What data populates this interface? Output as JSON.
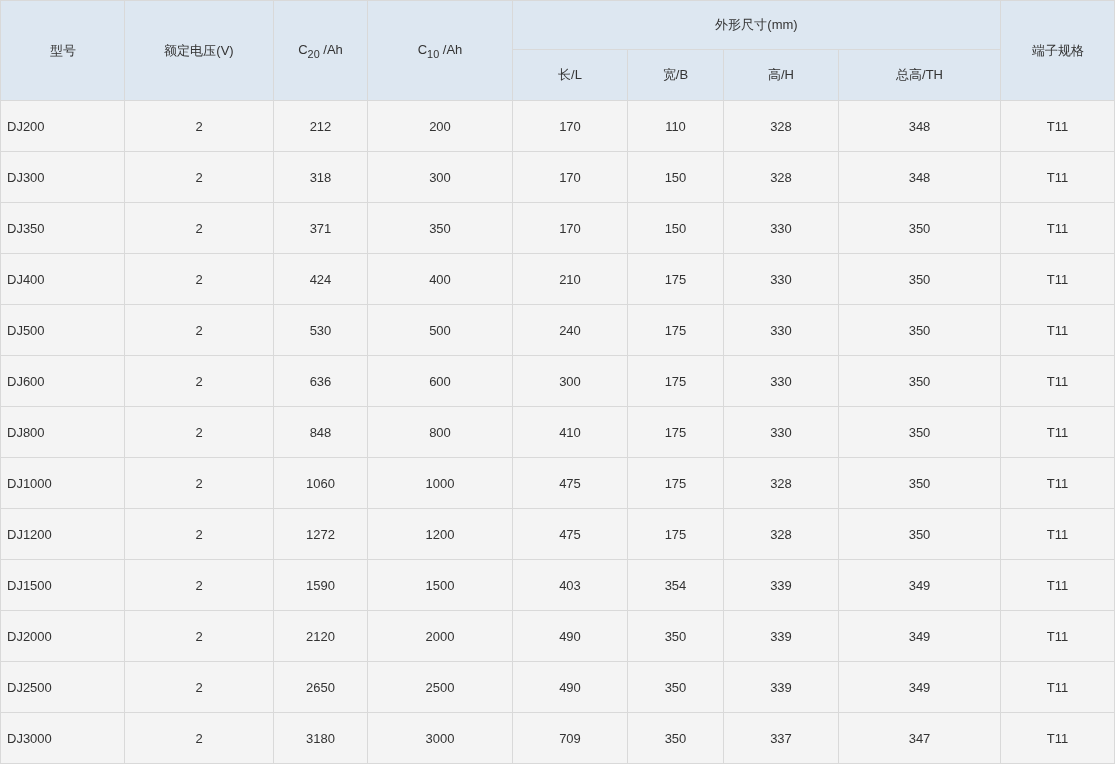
{
  "table": {
    "header_rows": [
      [
        {
          "label": "型号",
          "rowspan": 2
        },
        {
          "label": "额定电压(V)",
          "rowspan": 2
        },
        {
          "label": "C$_{20}$ /Ah",
          "rowspan": 2
        },
        {
          "label": "C$_{10}$ /Ah",
          "rowspan": 2
        },
        {
          "label": "外形尺寸(mm)",
          "colspan": 4
        },
        {
          "label": "端子规格",
          "rowspan": 2
        }
      ],
      [
        {
          "label": "长/L"
        },
        {
          "label": "宽/B"
        },
        {
          "label": "高/H"
        },
        {
          "label": "总高/TH"
        }
      ]
    ],
    "rows": [
      [
        "DJ200",
        "2",
        "212",
        "200",
        "170",
        "110",
        "328",
        "348",
        "T11"
      ],
      [
        "DJ300",
        "2",
        "318",
        "300",
        "170",
        "150",
        "328",
        "348",
        "T11"
      ],
      [
        "DJ350",
        "2",
        "371",
        "350",
        "170",
        "150",
        "330",
        "350",
        "T11"
      ],
      [
        "DJ400",
        "2",
        "424",
        "400",
        "210",
        "175",
        "330",
        "350",
        "T11"
      ],
      [
        "DJ500",
        "2",
        "530",
        "500",
        "240",
        "175",
        "330",
        "350",
        "T11"
      ],
      [
        "DJ600",
        "2",
        "636",
        "600",
        "300",
        "175",
        "330",
        "350",
        "T11"
      ],
      [
        "DJ800",
        "2",
        "848",
        "800",
        "410",
        "175",
        "330",
        "350",
        "T11"
      ],
      [
        "DJ1000",
        "2",
        "1060",
        "1000",
        "475",
        "175",
        "328",
        "350",
        "T11"
      ],
      [
        "DJ1200",
        "2",
        "1272",
        "1200",
        "475",
        "175",
        "328",
        "350",
        "T11"
      ],
      [
        "DJ1500",
        "2",
        "1590",
        "1500",
        "403",
        "354",
        "339",
        "349",
        "T11"
      ],
      [
        "DJ2000",
        "2",
        "2120",
        "2000",
        "490",
        "350",
        "339",
        "349",
        "T11"
      ],
      [
        "DJ2500",
        "2",
        "2650",
        "2500",
        "490",
        "350",
        "339",
        "349",
        "T11"
      ],
      [
        "DJ3000",
        "2",
        "3180",
        "3000",
        "709",
        "350",
        "337",
        "347",
        "T11"
      ]
    ]
  }
}
